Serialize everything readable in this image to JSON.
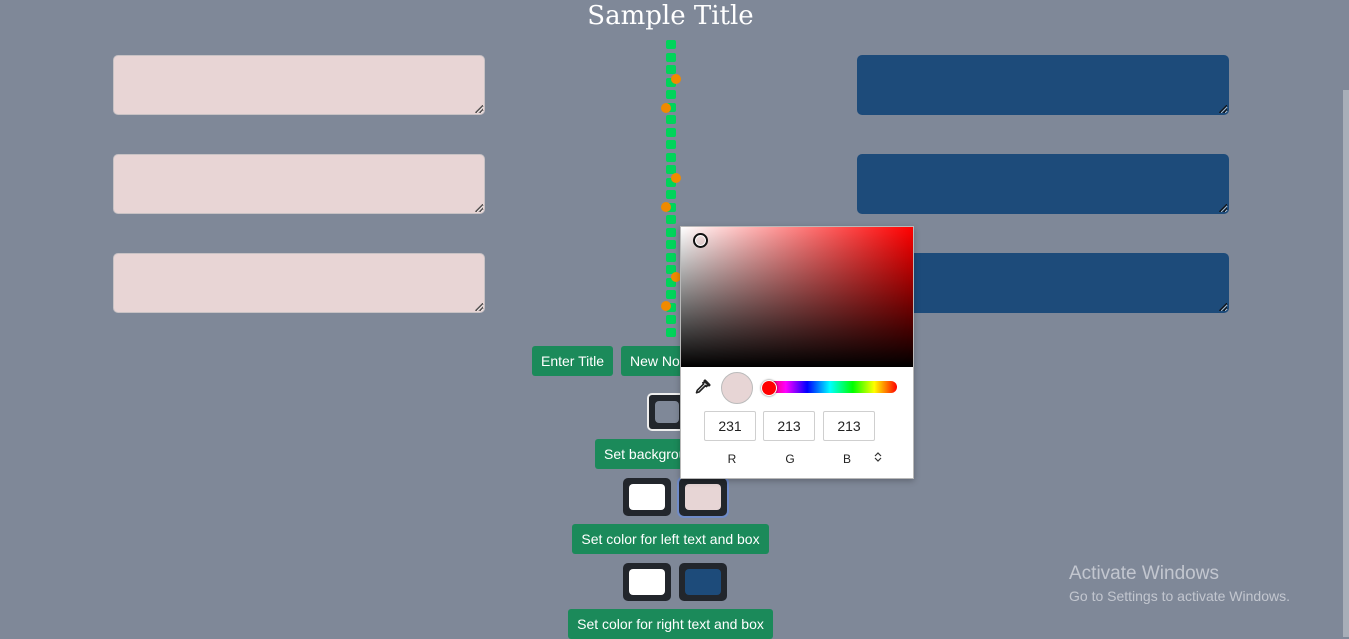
{
  "title": "Sample Title",
  "buttons": {
    "enter_title": "Enter Title",
    "new_note": "New Note",
    "set_background": "Set background color",
    "set_left": "Set color for left text and box",
    "set_right": "Set color for right text and box"
  },
  "left_boxes": [
    "",
    "",
    ""
  ],
  "right_boxes": [
    "",
    "",
    ""
  ],
  "colors": {
    "background": "#7f8898",
    "left_box": "#e8d5d5",
    "right_box": "#1d4b7a",
    "button": "#1b8a5a",
    "dots_green": "#00d45a",
    "dots_orange": "#f08a00"
  },
  "color_picker": {
    "r": "231",
    "g": "213",
    "b": "213",
    "r_label": "R",
    "g_label": "G",
    "b_label": "B",
    "mode_toggle_icon": "up-down-arrows-icon",
    "eyedropper_icon": "eyedropper-icon"
  },
  "watermark": {
    "line1": "Activate Windows",
    "line2": "Go to Settings to activate Windows."
  }
}
